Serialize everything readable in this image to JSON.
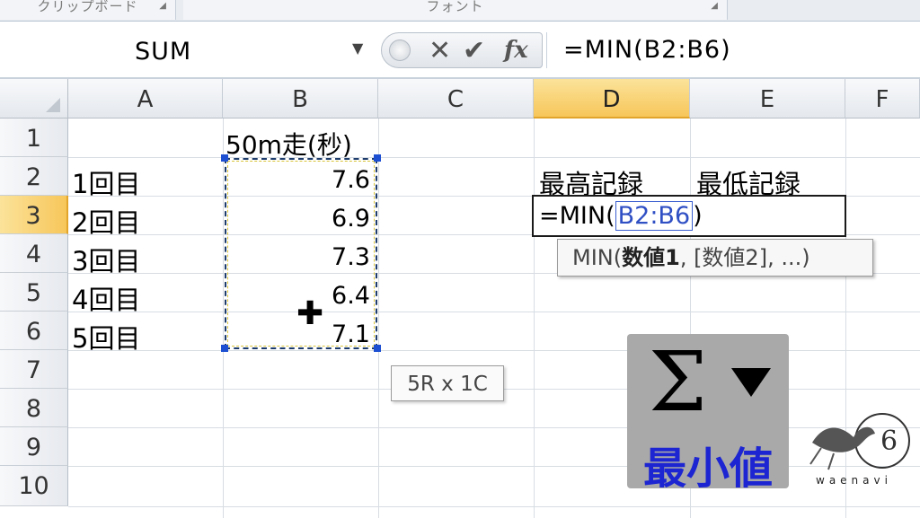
{
  "ribbon": {
    "groups": [
      {
        "label": "クリップボード"
      },
      {
        "label": "フォント"
      }
    ]
  },
  "formula_bar": {
    "name_box": "SUM",
    "cancel_symbol": "✕",
    "enter_symbol": "✔",
    "fx_symbol": "fx",
    "formula": "=MIN(B2:B6)"
  },
  "grid": {
    "columns": [
      "A",
      "B",
      "C",
      "D",
      "E",
      "F"
    ],
    "active_column": "D",
    "rows": [
      "1",
      "2",
      "3",
      "4",
      "5",
      "6",
      "7",
      "8",
      "9",
      "10"
    ],
    "active_row": "3"
  },
  "cells": {
    "B1": "50m走(秒)",
    "A2": "1回目",
    "A3": "2回目",
    "A4": "3回目",
    "A5": "4回目",
    "A6": "5回目",
    "B2": "7.6",
    "B3": "6.9",
    "B4": "7.3",
    "B5": "6.4",
    "B6": "7.1",
    "D2": "最高記録",
    "E2": "最低記録"
  },
  "edit_cell": {
    "prefix": "=MIN(",
    "ref": "B2:B6",
    "suffix": ")"
  },
  "tooltip": {
    "func": "MIN(",
    "arg1": "数値1",
    "rest": ", [数値2], ...)"
  },
  "selection_size": "5R x 1C",
  "overlay": {
    "caption": "最小値",
    "symbol": "Σ"
  },
  "logo": {
    "text": "waenavi"
  },
  "colors": {
    "active_header": "#f7c65a",
    "reference_blue": "#2f4fc4",
    "caption_blue": "#1c25d1"
  }
}
